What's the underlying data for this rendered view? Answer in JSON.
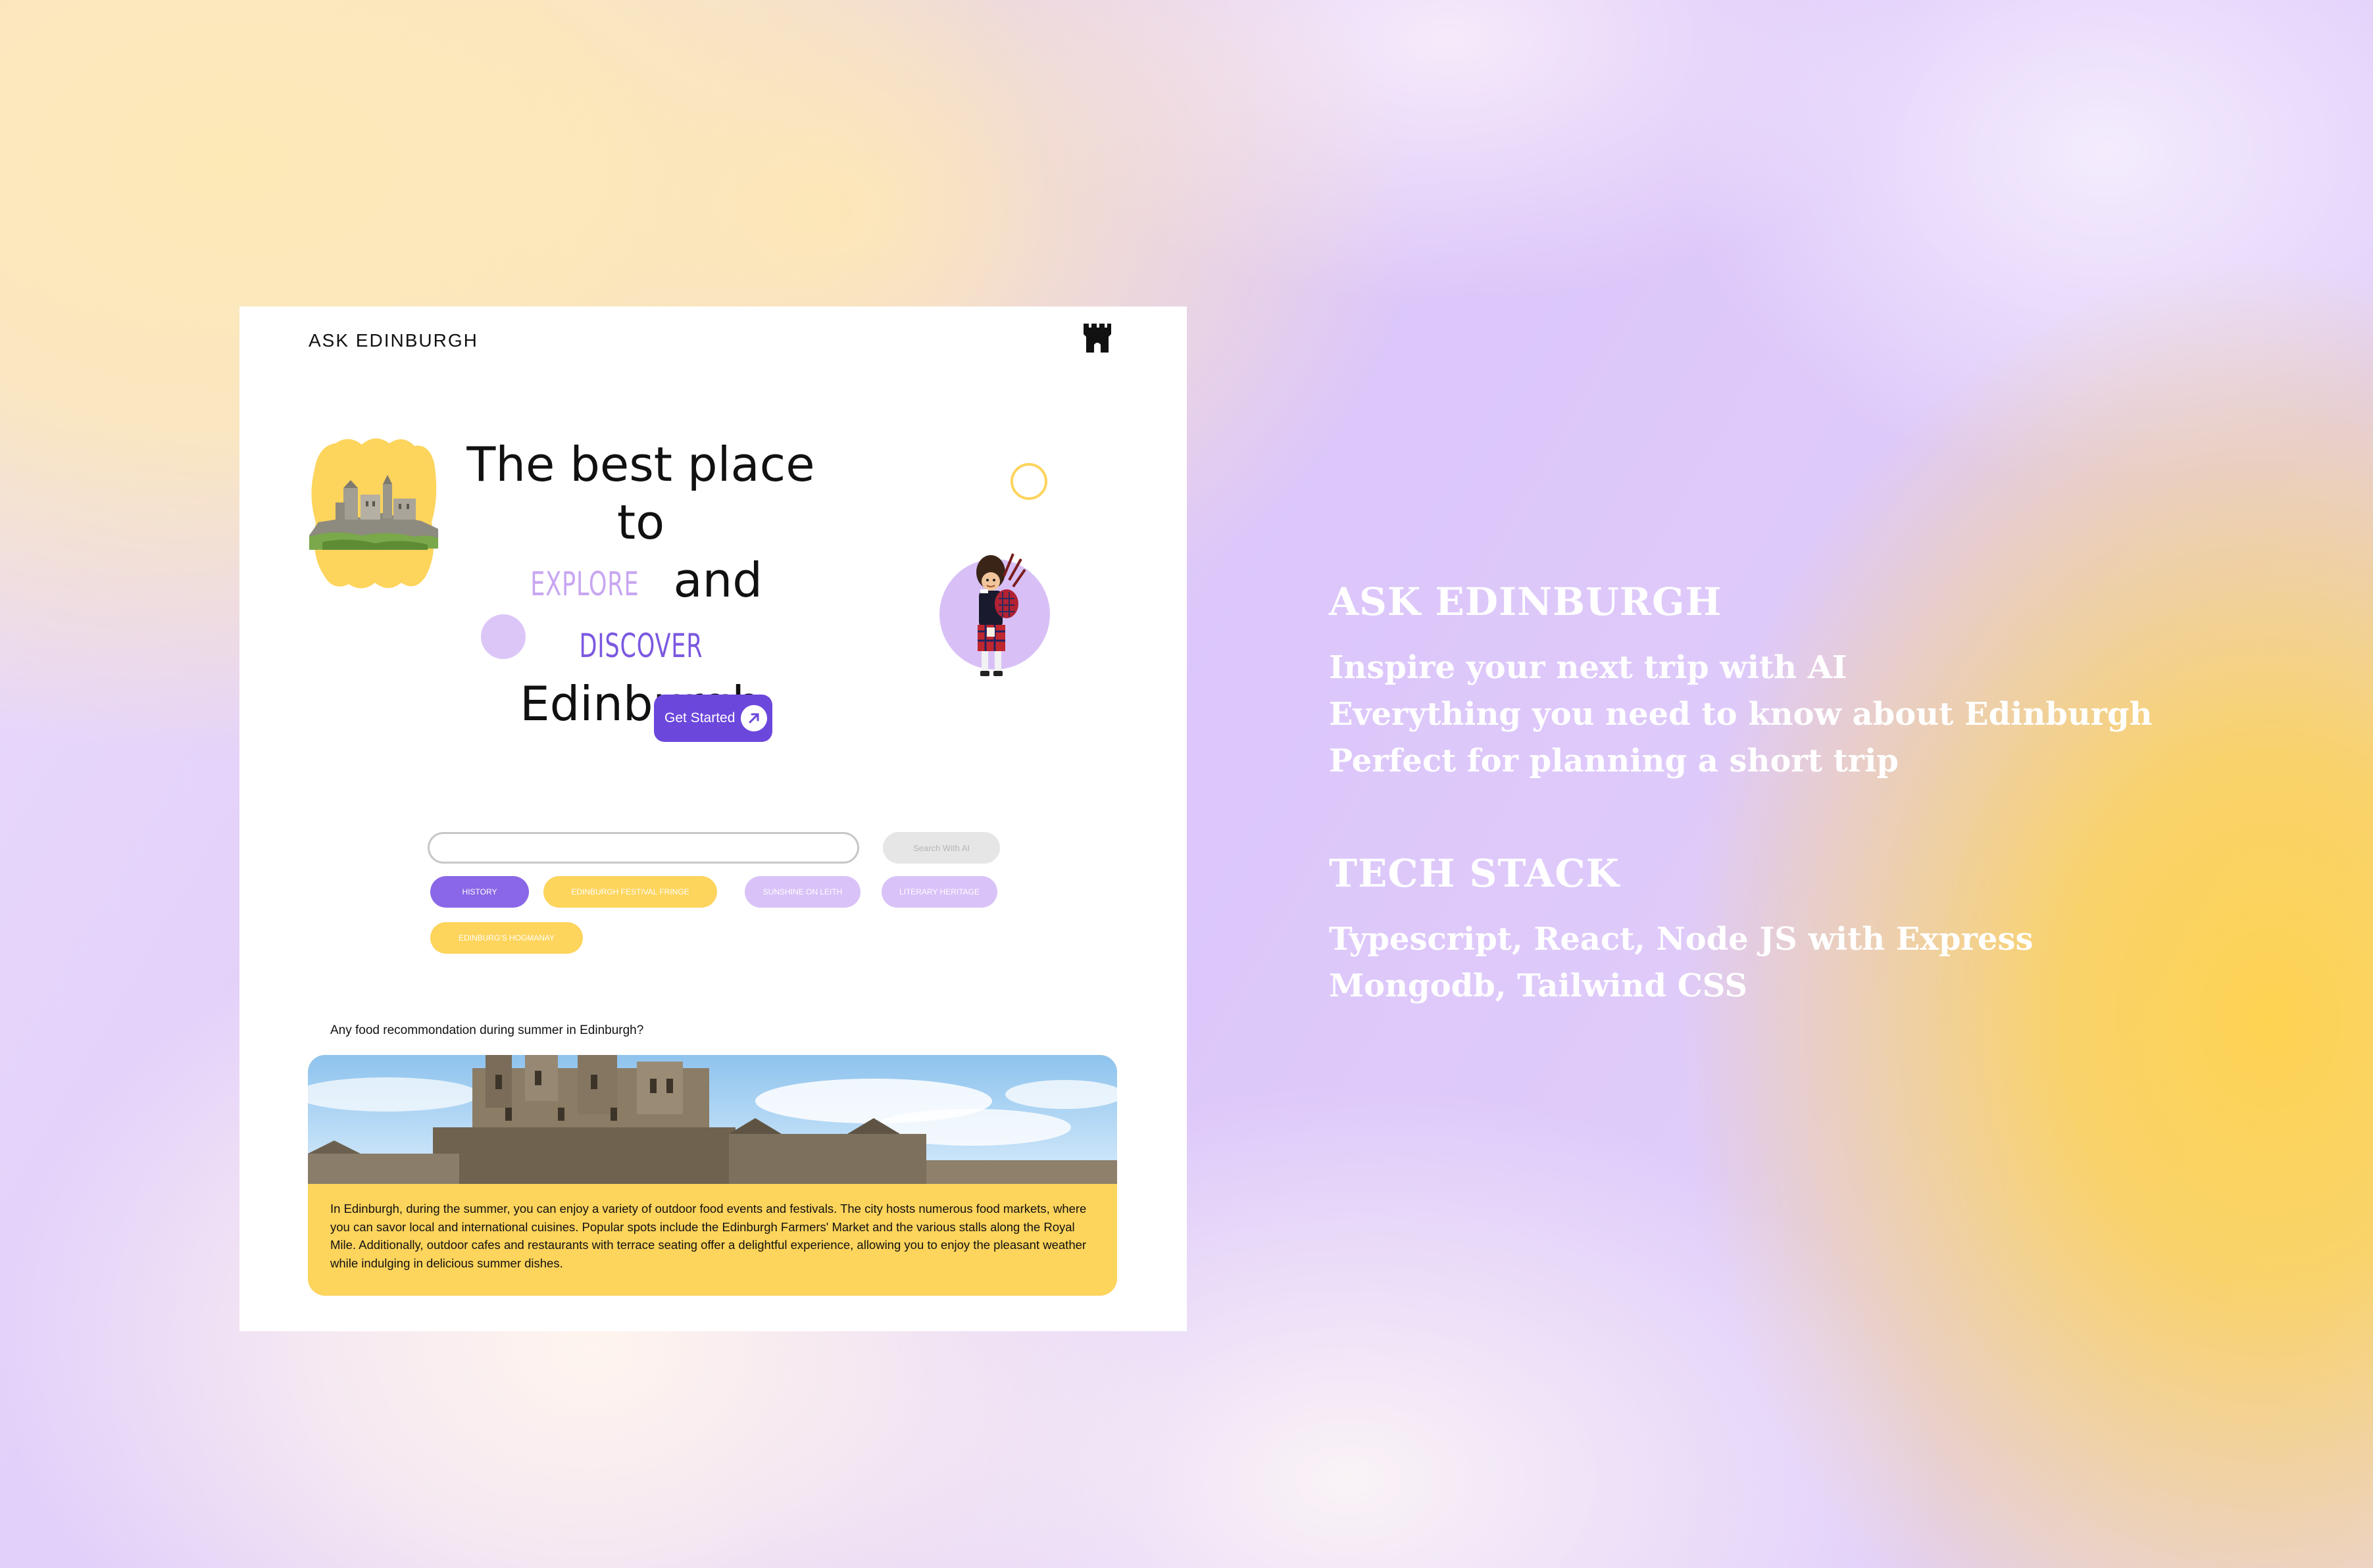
{
  "app": {
    "logo": "ASK EDINBURGH"
  },
  "hero": {
    "line1": "The best place to",
    "word_explore": "EXPLORE",
    "word_and": "and",
    "word_discover": "DISCOVER",
    "line3": "Edinburgh",
    "cta_label": "Get Started"
  },
  "search": {
    "input_value": "",
    "button_label": "Search With AI"
  },
  "chips": [
    {
      "label": "HISTORY",
      "selected": true
    },
    {
      "label": "EDINBURGH FESTIVAL FRINGE",
      "selected": false
    },
    {
      "label": "SUNSHINE ON LEITH",
      "selected": false
    },
    {
      "label": "LITERARY HERITAGE",
      "selected": false
    },
    {
      "label": "EDINBURG'S HOGMANAY",
      "selected": false
    }
  ],
  "conversation": {
    "question": "Any food recommondation during summer in Edinburgh?",
    "answer": "In Edinburgh, during the summer, you can enjoy a variety of outdoor food events and festivals. The city hosts numerous food markets, where you can savor local and international cuisines. Popular spots include the Edinburgh Farmers' Market and the various stalls along the Royal Mile. Additionally, outdoor cafes and restaurants with terrace seating offer a delightful experience, allowing you to enjoy the pleasant weather while indulging in delicious summer dishes."
  },
  "side": {
    "title": "ASK EDINBURGH",
    "lines": [
      "Inspire your next trip with AI",
      "Everything you need to know about Edinburgh",
      "Perfect for planning a short trip"
    ],
    "tech_title": "TECH STACK",
    "tech_lines": [
      "Typescript, React, Node JS with Express",
      "Mongodb, Tailwind CSS"
    ]
  },
  "icons": [
    "castle-icon",
    "arrow-up-right-icon",
    "edinburgh-castle-illustration",
    "bagpiper-illustration"
  ],
  "colors": {
    "accent_purple": "#6b47dc",
    "chip_purple": "#8a67e6",
    "chip_lavender": "#d9c2f8",
    "chip_yellow": "#fdd45c",
    "side_text": "#ffffff"
  }
}
